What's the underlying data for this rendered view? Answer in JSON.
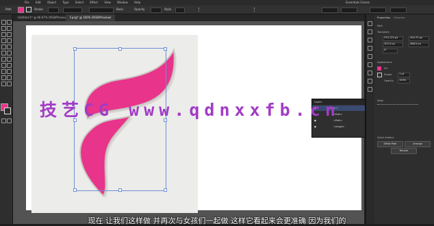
{
  "menubar": {
    "items": [
      "File",
      "Edit",
      "Object",
      "Type",
      "Select",
      "Effect",
      "View",
      "Window",
      "Help"
    ],
    "workspace": "Essentials Classic"
  },
  "controlbar": {
    "stroke_label": "Stroke",
    "style_label": "Basic",
    "opacity_label": "Opacity",
    "opacity_value": "100%",
    "style2": "Style",
    "fill_color": "#e8348a"
  },
  "tabs": [
    {
      "label": "Untitled-1* @ 66.67% (RGB/Preview)"
    },
    {
      "label": "F.png* @ 100% (RGB/Preview)"
    }
  ],
  "properties": {
    "tabs": [
      "Properties",
      "Libraries"
    ],
    "section_path": "Path",
    "transform_label": "Transform",
    "x_value": "370.125 px",
    "y_value": "325.5 px",
    "w_value": "204.75 px",
    "h_value": "388.5 px",
    "angle_value": "0°",
    "appearance_label": "Appearance",
    "fill_label": "Fill",
    "stroke_label": "Stroke",
    "stroke_weight": "1 pt",
    "opacity_label": "Opacity",
    "opacity_value": "100%",
    "align_label": "Align",
    "quick_actions_label": "Quick Actions",
    "btn_offset": "Offset Path",
    "btn_arrange": "Arrange",
    "btn_recolor": "Recolor"
  },
  "layers": {
    "title": "Layers",
    "rows": [
      "Layer 1",
      "<Path>",
      "<Path>",
      "<Image>"
    ]
  },
  "watermark": "技艺CG www.qdnxxfb.cn",
  "subtitle": "现在 让我们这样做 并再次与女孩们一起做 这样它看起来会更准确 因为我们的",
  "colors": {
    "pink": "#e8348a",
    "selection": "#6f8fd8",
    "watermark": "#a23cc4"
  }
}
